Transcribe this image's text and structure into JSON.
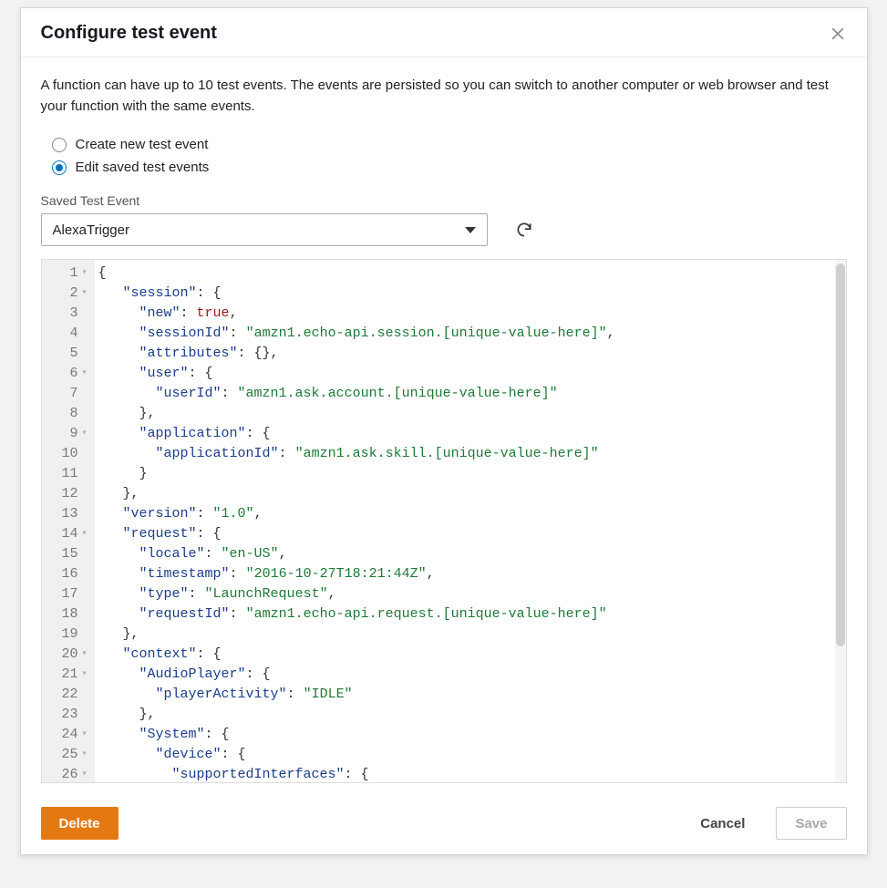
{
  "header": {
    "title": "Configure test event"
  },
  "description": "A function can have up to 10 test events. The events are persisted so you can switch to another computer or web browser and test your function with the same events.",
  "radios": {
    "create": "Create new test event",
    "edit": "Edit saved test events",
    "selected": "edit"
  },
  "savedEvent": {
    "label": "Saved Test Event",
    "selected": "AlexaTrigger"
  },
  "editor": {
    "gutter": [
      {
        "n": "1",
        "fold": true
      },
      {
        "n": "2",
        "fold": true
      },
      {
        "n": "3",
        "fold": false
      },
      {
        "n": "4",
        "fold": false
      },
      {
        "n": "5",
        "fold": false
      },
      {
        "n": "6",
        "fold": true
      },
      {
        "n": "7",
        "fold": false
      },
      {
        "n": "8",
        "fold": false
      },
      {
        "n": "9",
        "fold": true
      },
      {
        "n": "10",
        "fold": false
      },
      {
        "n": "11",
        "fold": false
      },
      {
        "n": "12",
        "fold": false
      },
      {
        "n": "13",
        "fold": false
      },
      {
        "n": "14",
        "fold": true
      },
      {
        "n": "15",
        "fold": false
      },
      {
        "n": "16",
        "fold": false
      },
      {
        "n": "17",
        "fold": false
      },
      {
        "n": "18",
        "fold": false
      },
      {
        "n": "19",
        "fold": false
      },
      {
        "n": "20",
        "fold": true
      },
      {
        "n": "21",
        "fold": true
      },
      {
        "n": "22",
        "fold": false
      },
      {
        "n": "23",
        "fold": false
      },
      {
        "n": "24",
        "fold": true
      },
      {
        "n": "25",
        "fold": true
      },
      {
        "n": "26",
        "fold": true
      }
    ],
    "lines": [
      [
        {
          "t": "{",
          "c": "punc"
        }
      ],
      [
        {
          "t": "   ",
          "c": "punc"
        },
        {
          "t": "\"session\"",
          "c": "key"
        },
        {
          "t": ": {",
          "c": "punc"
        }
      ],
      [
        {
          "t": "     ",
          "c": "punc"
        },
        {
          "t": "\"new\"",
          "c": "key"
        },
        {
          "t": ": ",
          "c": "punc"
        },
        {
          "t": "true",
          "c": "bool"
        },
        {
          "t": ",",
          "c": "punc"
        }
      ],
      [
        {
          "t": "     ",
          "c": "punc"
        },
        {
          "t": "\"sessionId\"",
          "c": "key"
        },
        {
          "t": ": ",
          "c": "punc"
        },
        {
          "t": "\"amzn1.echo-api.session.[unique-value-here]\"",
          "c": "str"
        },
        {
          "t": ",",
          "c": "punc"
        }
      ],
      [
        {
          "t": "     ",
          "c": "punc"
        },
        {
          "t": "\"attributes\"",
          "c": "key"
        },
        {
          "t": ": {},",
          "c": "punc"
        }
      ],
      [
        {
          "t": "     ",
          "c": "punc"
        },
        {
          "t": "\"user\"",
          "c": "key"
        },
        {
          "t": ": {",
          "c": "punc"
        }
      ],
      [
        {
          "t": "       ",
          "c": "punc"
        },
        {
          "t": "\"userId\"",
          "c": "key"
        },
        {
          "t": ": ",
          "c": "punc"
        },
        {
          "t": "\"amzn1.ask.account.[unique-value-here]\"",
          "c": "str"
        }
      ],
      [
        {
          "t": "     },",
          "c": "punc"
        }
      ],
      [
        {
          "t": "     ",
          "c": "punc"
        },
        {
          "t": "\"application\"",
          "c": "key"
        },
        {
          "t": ": {",
          "c": "punc"
        }
      ],
      [
        {
          "t": "       ",
          "c": "punc"
        },
        {
          "t": "\"applicationId\"",
          "c": "key"
        },
        {
          "t": ": ",
          "c": "punc"
        },
        {
          "t": "\"amzn1.ask.skill.[unique-value-here]\"",
          "c": "str"
        }
      ],
      [
        {
          "t": "     }",
          "c": "punc"
        }
      ],
      [
        {
          "t": "   },",
          "c": "punc"
        }
      ],
      [
        {
          "t": "   ",
          "c": "punc"
        },
        {
          "t": "\"version\"",
          "c": "key"
        },
        {
          "t": ": ",
          "c": "punc"
        },
        {
          "t": "\"1.0\"",
          "c": "str"
        },
        {
          "t": ",",
          "c": "punc"
        }
      ],
      [
        {
          "t": "   ",
          "c": "punc"
        },
        {
          "t": "\"request\"",
          "c": "key"
        },
        {
          "t": ": {",
          "c": "punc"
        }
      ],
      [
        {
          "t": "     ",
          "c": "punc"
        },
        {
          "t": "\"locale\"",
          "c": "key"
        },
        {
          "t": ": ",
          "c": "punc"
        },
        {
          "t": "\"en-US\"",
          "c": "str"
        },
        {
          "t": ",",
          "c": "punc"
        }
      ],
      [
        {
          "t": "     ",
          "c": "punc"
        },
        {
          "t": "\"timestamp\"",
          "c": "key"
        },
        {
          "t": ": ",
          "c": "punc"
        },
        {
          "t": "\"2016-10-27T18:21:44Z\"",
          "c": "str"
        },
        {
          "t": ",",
          "c": "punc"
        }
      ],
      [
        {
          "t": "     ",
          "c": "punc"
        },
        {
          "t": "\"type\"",
          "c": "key"
        },
        {
          "t": ": ",
          "c": "punc"
        },
        {
          "t": "\"LaunchRequest\"",
          "c": "str"
        },
        {
          "t": ",",
          "c": "punc"
        }
      ],
      [
        {
          "t": "     ",
          "c": "punc"
        },
        {
          "t": "\"requestId\"",
          "c": "key"
        },
        {
          "t": ": ",
          "c": "punc"
        },
        {
          "t": "\"amzn1.echo-api.request.[unique-value-here]\"",
          "c": "str"
        }
      ],
      [
        {
          "t": "   },",
          "c": "punc"
        }
      ],
      [
        {
          "t": "   ",
          "c": "punc"
        },
        {
          "t": "\"context\"",
          "c": "key"
        },
        {
          "t": ": {",
          "c": "punc"
        }
      ],
      [
        {
          "t": "     ",
          "c": "punc"
        },
        {
          "t": "\"AudioPlayer\"",
          "c": "key"
        },
        {
          "t": ": {",
          "c": "punc"
        }
      ],
      [
        {
          "t": "       ",
          "c": "punc"
        },
        {
          "t": "\"playerActivity\"",
          "c": "key"
        },
        {
          "t": ": ",
          "c": "punc"
        },
        {
          "t": "\"IDLE\"",
          "c": "str"
        }
      ],
      [
        {
          "t": "     },",
          "c": "punc"
        }
      ],
      [
        {
          "t": "     ",
          "c": "punc"
        },
        {
          "t": "\"System\"",
          "c": "key"
        },
        {
          "t": ": {",
          "c": "punc"
        }
      ],
      [
        {
          "t": "       ",
          "c": "punc"
        },
        {
          "t": "\"device\"",
          "c": "key"
        },
        {
          "t": ": {",
          "c": "punc"
        }
      ],
      [
        {
          "t": "         ",
          "c": "punc"
        },
        {
          "t": "\"supportedInterfaces\"",
          "c": "key"
        },
        {
          "t": ": {",
          "c": "punc"
        }
      ]
    ]
  },
  "footer": {
    "delete": "Delete",
    "cancel": "Cancel",
    "save": "Save"
  }
}
